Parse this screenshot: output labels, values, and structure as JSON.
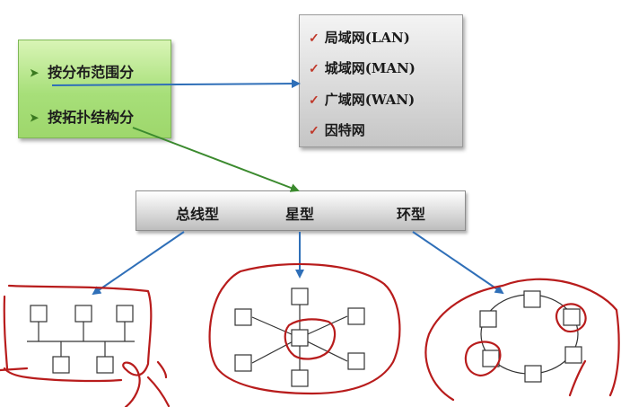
{
  "classification": {
    "items": [
      {
        "label": "按分布范围分"
      },
      {
        "label": "按拓扑结构分"
      }
    ]
  },
  "range_types": {
    "items": [
      {
        "label": "局域网(LAN)"
      },
      {
        "label": "城域网(MAN)"
      },
      {
        "label": "广域网(WAN)"
      },
      {
        "label": "因特网"
      }
    ]
  },
  "topologies": {
    "items": [
      {
        "label": "总线型"
      },
      {
        "label": "星型"
      },
      {
        "label": "环型"
      }
    ]
  },
  "colors": {
    "blue_arrow": "#2f6fb8",
    "green_arrow": "#3b8a2e",
    "ink_red": "#b81c1c",
    "node_stroke": "#333333"
  }
}
